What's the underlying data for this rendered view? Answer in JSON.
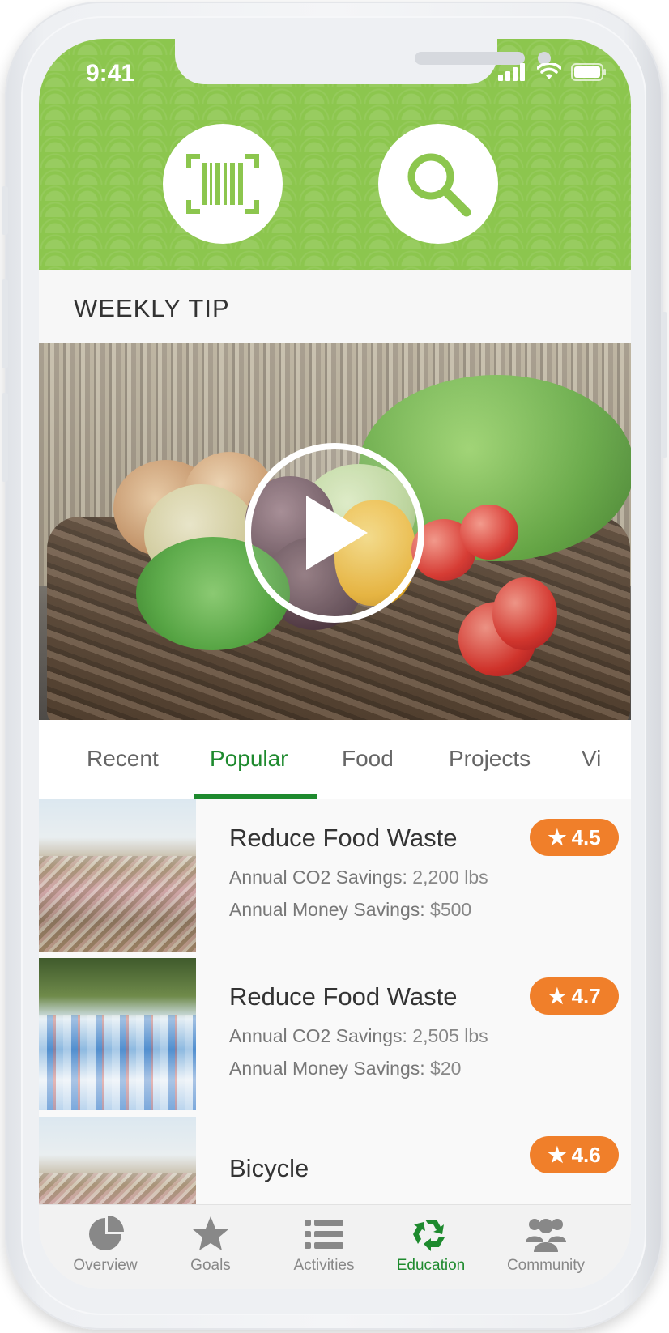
{
  "status_bar": {
    "time": "9:41"
  },
  "header": {
    "scan_button_icon": "barcode-scan-icon",
    "search_button_icon": "search-icon",
    "accent_color": "#8cc64e"
  },
  "weekly_tip": {
    "title": "WEEKLY TIP",
    "play_icon": "play-icon"
  },
  "tabs": [
    {
      "label": "Recent",
      "active": false
    },
    {
      "label": "Popular",
      "active": true
    },
    {
      "label": "Food",
      "active": false
    },
    {
      "label": "Projects",
      "active": false
    },
    {
      "label": "Vi",
      "active": false
    }
  ],
  "items": [
    {
      "title": "Reduce Food Waste",
      "co2_label": "Annual CO2 Savings:",
      "co2_value": "2,200 lbs",
      "money_label": "Annual Money Savings:",
      "money_value": "$500",
      "rating": "4.5"
    },
    {
      "title": "Reduce Food Waste",
      "co2_label": "Annual CO2 Savings:",
      "co2_value": "2,505 lbs",
      "money_label": "Annual Money Savings:",
      "money_value": "$20",
      "rating": "4.7"
    },
    {
      "title": "Bicycle",
      "rating": "4.6"
    }
  ],
  "bottom_nav": [
    {
      "label": "Overview",
      "icon": "pie-chart-icon",
      "active": false
    },
    {
      "label": "Goals",
      "icon": "star-icon",
      "active": false
    },
    {
      "label": "Activities",
      "icon": "list-icon",
      "active": false
    },
    {
      "label": "Education",
      "icon": "recycle-icon",
      "active": true
    },
    {
      "label": "Community",
      "icon": "people-icon",
      "active": false
    }
  ],
  "colors": {
    "active_green": "#1e8a2e",
    "rating_orange": "#f07f2a"
  }
}
